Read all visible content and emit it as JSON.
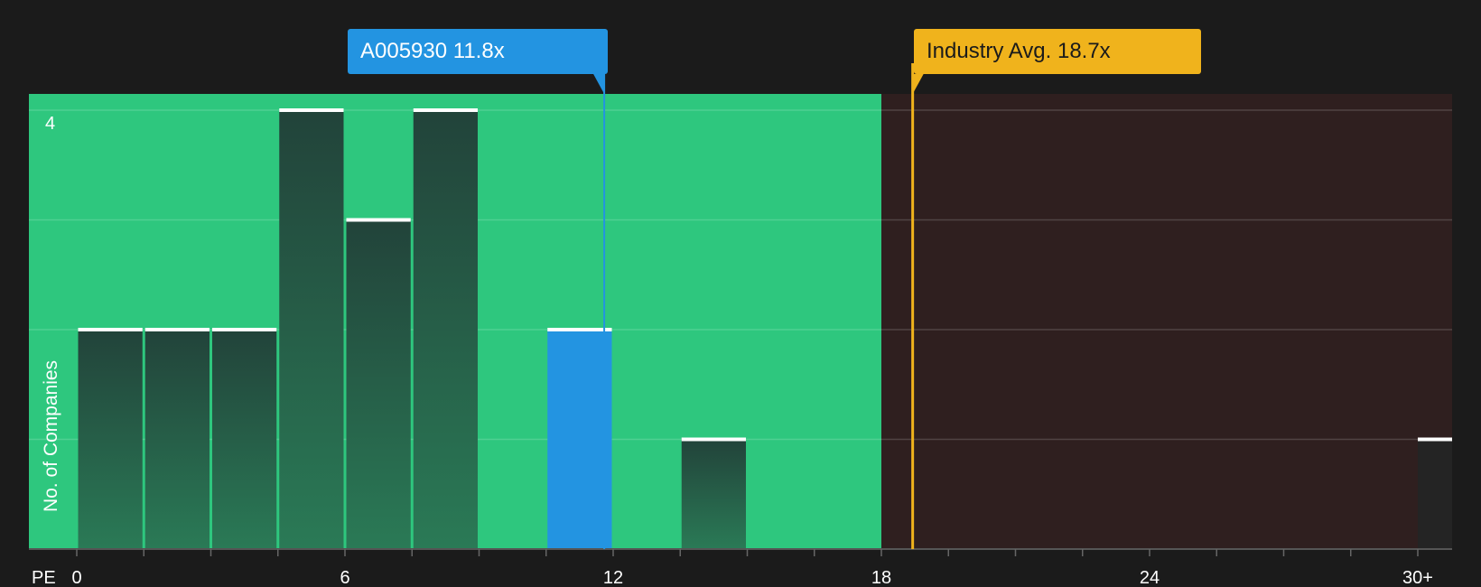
{
  "chart_data": {
    "type": "bar",
    "xlabel": "PE",
    "ylabel": "No. of Companies",
    "xlim": [
      0,
      30
    ],
    "ylim": [
      0,
      4
    ],
    "x_ticks": [
      "0",
      "6",
      "12",
      "18",
      "24",
      "30+"
    ],
    "y_ticks": [
      "4"
    ],
    "bin_width": 1.5,
    "bins": [
      {
        "start": 0.0,
        "count": 2
      },
      {
        "start": 1.5,
        "count": 2
      },
      {
        "start": 3.0,
        "count": 2
      },
      {
        "start": 4.5,
        "count": 4
      },
      {
        "start": 6.0,
        "count": 3
      },
      {
        "start": 7.5,
        "count": 4
      },
      {
        "start": 10.5,
        "count": 2,
        "highlight": true
      },
      {
        "start": 13.5,
        "count": 1
      },
      {
        "start": 30.0,
        "count": 1
      }
    ],
    "company": {
      "label": "A005930 11.8x",
      "value": 11.8
    },
    "industry": {
      "label": "Industry Avg. 18.7x",
      "value": 18.7
    },
    "colors": {
      "background": "#1b1b1b",
      "undervalued_zone": "#2ec77e",
      "overvalued_zone": "#2f1f1f",
      "bar_top": "#22433a",
      "bar_bottom": "#2a7a56",
      "company": "#2394e1",
      "industry": "#f0b31c"
    }
  }
}
